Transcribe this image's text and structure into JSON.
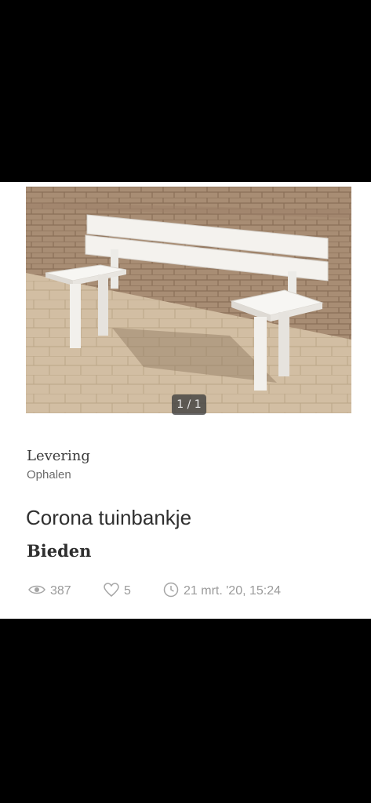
{
  "listing": {
    "image_counter": "1 / 1",
    "delivery_label": "Levering",
    "delivery_value": "Ophalen",
    "title": "Corona tuinbankje",
    "price": "Bieden",
    "stats": {
      "views": "387",
      "likes": "5",
      "date": "21 mrt. '20, 15:24"
    },
    "icons": {
      "views": "eye-icon",
      "likes": "heart-icon",
      "date": "clock-icon"
    }
  }
}
